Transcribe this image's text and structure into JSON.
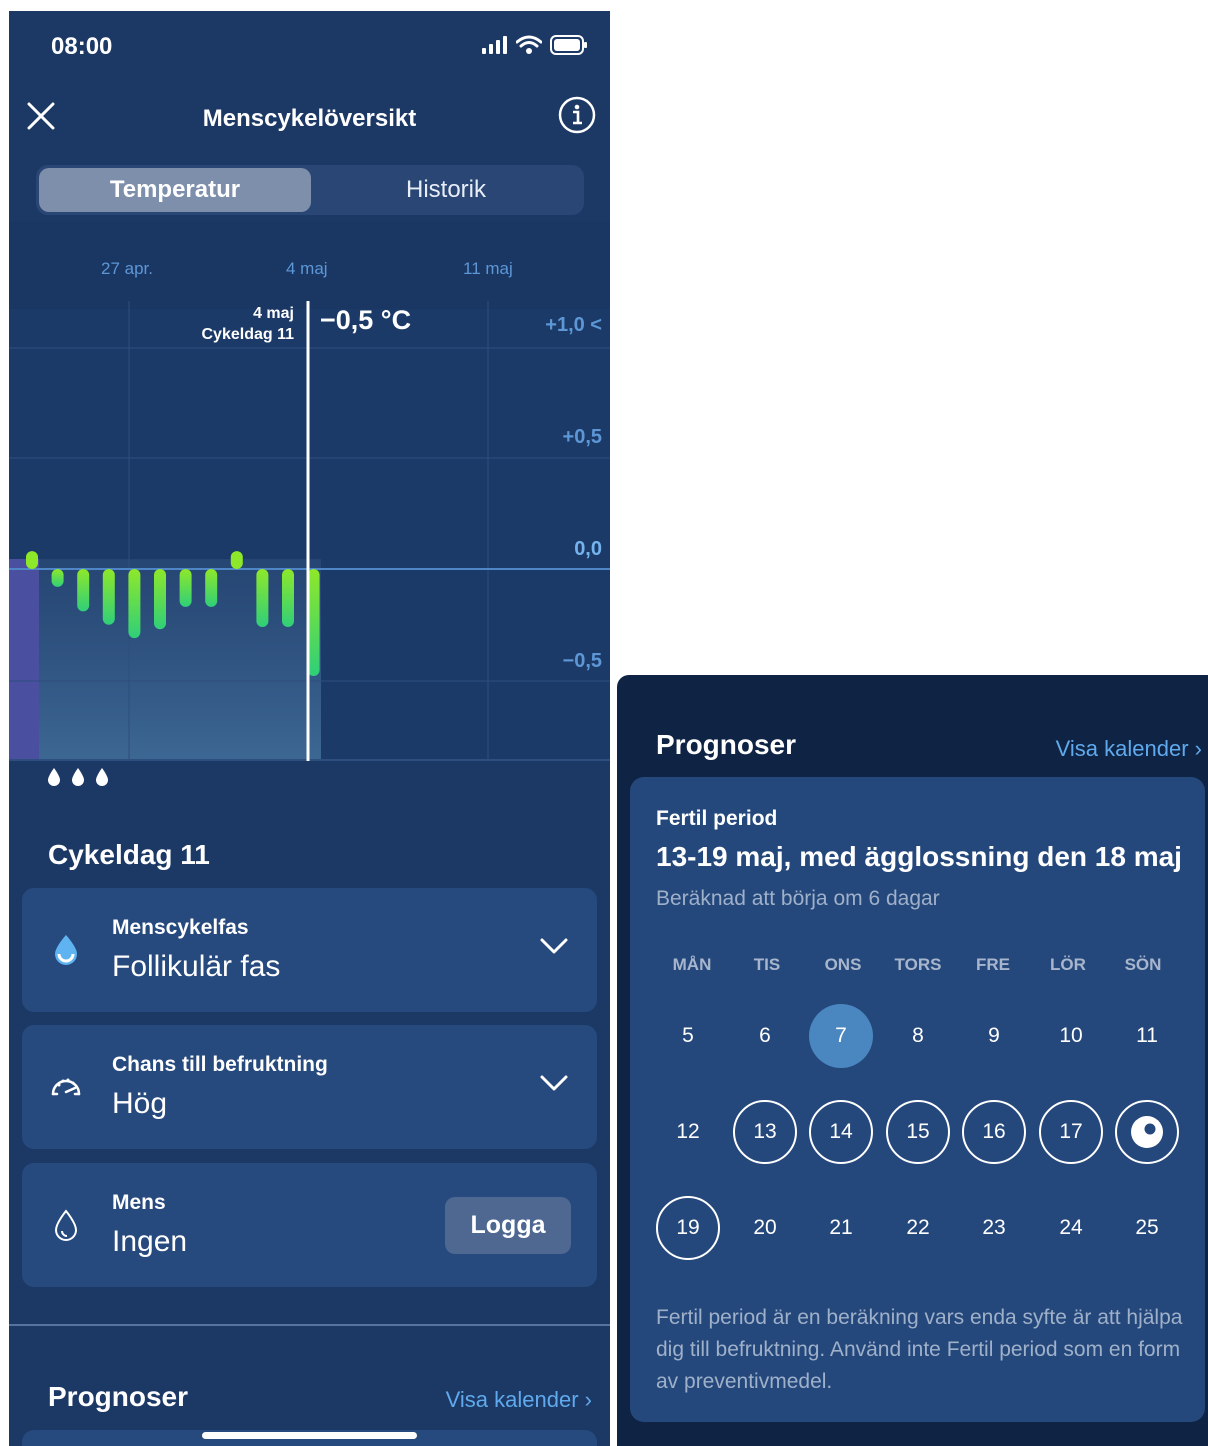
{
  "status_bar": {
    "time": "08:00"
  },
  "nav": {
    "title": "Menscykelöversikt"
  },
  "segmented": {
    "active_label": "Temperatur",
    "inactive_label": "Historik"
  },
  "chart_data": {
    "type": "bar",
    "date_labels": [
      "27 apr.",
      "4 maj",
      "11 maj"
    ],
    "y_ticks": [
      "+1,0",
      "+0,5",
      "0,0",
      "−0,5"
    ],
    "ylim": [
      -0.9,
      1.1
    ],
    "values": [
      0.08,
      -0.08,
      -0.19,
      -0.25,
      -0.31,
      -0.27,
      -0.17,
      -0.17,
      0.08,
      -0.26,
      -0.26,
      -0.48
    ],
    "selected": {
      "date": "4 maj",
      "day": "Cykeldag 11",
      "value": "−0,5 °C"
    }
  },
  "cycle_day_title": "Cykeldag 11",
  "cards": [
    {
      "label": "Menscykelfas",
      "value": "Follikulär fas"
    },
    {
      "label": "Chans till befruktning",
      "value": "Hög"
    },
    {
      "label": "Mens",
      "value": "Ingen",
      "button": "Logga"
    }
  ],
  "prognoser": {
    "title": "Prognoser",
    "link": "Visa kalender",
    "fertile_label": "Fertil period",
    "fertile_range": "13-19 maj, med ägglossning den 18 maj",
    "fertile_sub": "Beräknad att börja om 6 dagar",
    "weekdays": [
      "MÅN",
      "TIS",
      "ONS",
      "TORS",
      "FRE",
      "LÖR",
      "SÖN"
    ],
    "week1": [
      "5",
      "6",
      "7",
      "8",
      "9",
      "10",
      "11"
    ],
    "week2": [
      "12",
      "13",
      "14",
      "15",
      "16",
      "17",
      ""
    ],
    "week3": [
      "19",
      "20",
      "21",
      "22",
      "23",
      "24",
      "25"
    ],
    "disclaimer": "Fertil period är en beräkning vars enda syfte är att hjälpa dig till befruktning. Använd inte Fertil period som en form av preventivmedel."
  },
  "colors": {
    "accent_blue": "#5fa9ec",
    "bar_green": "#8ee82a",
    "today": "#4a86c0"
  }
}
